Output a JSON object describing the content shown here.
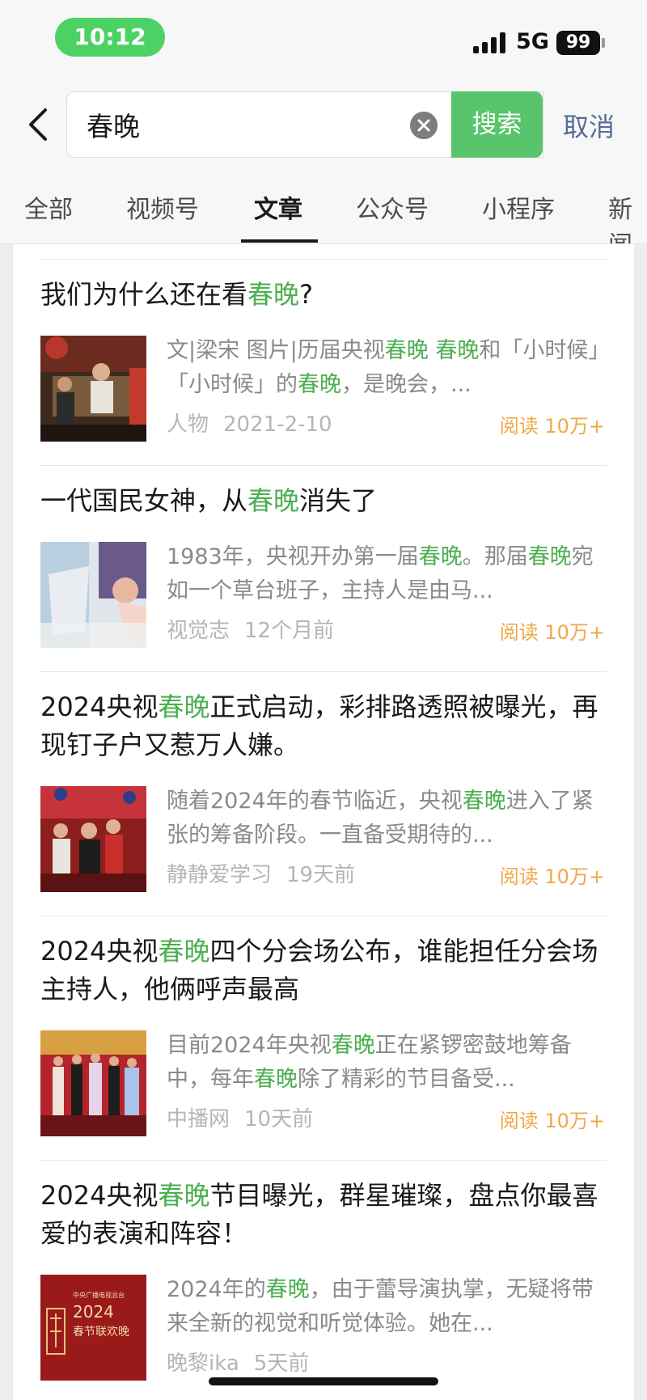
{
  "status": {
    "time": "10:12",
    "network": "5G",
    "battery": "99"
  },
  "search": {
    "query": "春晚",
    "button": "搜索",
    "cancel": "取消"
  },
  "tabs": [
    "全部",
    "视频号",
    "文章",
    "公众号",
    "小程序",
    "新闻"
  ],
  "active_tab": "文章",
  "articles": [
    {
      "title": [
        {
          "t": "我们为什么还在看"
        },
        {
          "t": "春晚",
          "hl": true
        },
        {
          "t": "?"
        }
      ],
      "desc": [
        {
          "t": "文|梁宋 图片|历届央视"
        },
        {
          "t": "春晚",
          "hl": true
        },
        {
          "t": " "
        },
        {
          "t": "春晚",
          "hl": true
        },
        {
          "t": "和「小时候」「小时候」的"
        },
        {
          "t": "春晚",
          "hl": true
        },
        {
          "t": "，是晚会，..."
        }
      ],
      "source": "人物",
      "date": "2021-2-10",
      "reads": "阅读 10万+",
      "thumb": "stage-performance-image"
    },
    {
      "title": [
        {
          "t": "一代国民女神，从"
        },
        {
          "t": "春晚",
          "hl": true
        },
        {
          "t": "消失了"
        }
      ],
      "desc": [
        {
          "t": "1983年，央视开办第一届"
        },
        {
          "t": "春晚",
          "hl": true
        },
        {
          "t": "。那届"
        },
        {
          "t": "春晚",
          "hl": true
        },
        {
          "t": "宛如一个草台班子，主持人是由马..."
        }
      ],
      "source": "视觉志",
      "date": "12个月前",
      "reads": "阅读 10万+",
      "thumb": "actress-portrait-image"
    },
    {
      "title": [
        {
          "t": "2024央视"
        },
        {
          "t": "春晚",
          "hl": true
        },
        {
          "t": "正式启动，彩排路透照被曝光，再现钉子户又惹万人嫌。"
        }
      ],
      "desc": [
        {
          "t": "随着2024年的春节临近，央视"
        },
        {
          "t": "春晚",
          "hl": true
        },
        {
          "t": "进入了紧张的筹备阶段。一直备受期待的..."
        }
      ],
      "source": "静静爱学习",
      "date": "19天前",
      "reads": "阅读 10万+",
      "thumb": "rehearsal-image"
    },
    {
      "title": [
        {
          "t": "2024央视"
        },
        {
          "t": "春晚",
          "hl": true
        },
        {
          "t": "四个分会场公布，谁能担任分会场主持人，他俩呼声最高"
        }
      ],
      "desc": [
        {
          "t": "目前2024年央视"
        },
        {
          "t": "春晚",
          "hl": true
        },
        {
          "t": "正在紧锣密鼓地筹备中，每年"
        },
        {
          "t": "春晚",
          "hl": true
        },
        {
          "t": "除了精彩的节目备受..."
        }
      ],
      "source": "中播网",
      "date": "10天前",
      "reads": "阅读 10万+",
      "thumb": "hosts-on-stage-image"
    },
    {
      "title": [
        {
          "t": "2024央视"
        },
        {
          "t": "春晚",
          "hl": true
        },
        {
          "t": "节目曝光，群星璀璨，盘点你最喜爱的表演和阵容！"
        }
      ],
      "desc": [
        {
          "t": "2024年的"
        },
        {
          "t": "春晚",
          "hl": true
        },
        {
          "t": "，由于蕾导演执掌，无疑将带来全新的视觉和听觉体验。她在..."
        }
      ],
      "source": "晚黎ika",
      "date": "5天前",
      "reads": "",
      "thumb": "gala-poster-image",
      "poster": {
        "line1": "中央广播电视总台",
        "year": "2024",
        "line2": "春节联欢晚"
      }
    }
  ],
  "colors": {
    "accent_green": "#58c46b",
    "highlight_green": "#4caf50",
    "link_blue": "#576b95",
    "reads_orange": "#f0a848"
  }
}
